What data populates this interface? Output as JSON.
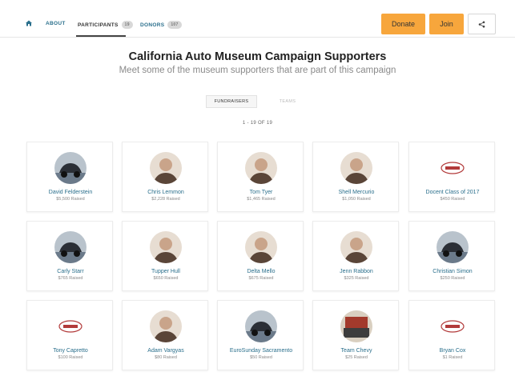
{
  "nav": {
    "about": "ABOUT",
    "participants": "PARTICIPANTS",
    "participants_count": "19",
    "donors": "DONORS",
    "donors_count": "107"
  },
  "actions": {
    "donate": "Donate",
    "join": "Join"
  },
  "header": {
    "title": "California Auto Museum Campaign Supporters",
    "subtitle": "Meet some of the museum supporters that are part of this campaign"
  },
  "tabs": {
    "fundraisers": "FUNDRAISERS",
    "teams": "TEAMS"
  },
  "count_text": "1 - 19 OF 19",
  "colors": {
    "accent": "#f7a63c",
    "link": "#2a6f8c"
  },
  "participants": [
    {
      "name": "David Felderstein",
      "raised": "$5,500 Raised",
      "avatar": "car-photo"
    },
    {
      "name": "Chris Lemmon",
      "raised": "$2,228 Raised",
      "avatar": "person-photo"
    },
    {
      "name": "Tom Tyer",
      "raised": "$1,465 Raised",
      "avatar": "person-photo"
    },
    {
      "name": "Shell Mercurio",
      "raised": "$1,050 Raised",
      "avatar": "person-photo"
    },
    {
      "name": "Docent Class of 2017",
      "raised": "$450 Raised",
      "avatar": "museum-logo"
    },
    {
      "name": "Carly Starr",
      "raised": "$765 Raised",
      "avatar": "car-photo"
    },
    {
      "name": "Tupper Hull",
      "raised": "$650 Raised",
      "avatar": "person-photo"
    },
    {
      "name": "Delta Mello",
      "raised": "$675 Raised",
      "avatar": "person-photo"
    },
    {
      "name": "Jenn Rabbon",
      "raised": "$325 Raised",
      "avatar": "person-photo"
    },
    {
      "name": "Christian Simon",
      "raised": "$250 Raised",
      "avatar": "car-photo"
    },
    {
      "name": "Tony Capretto",
      "raised": "$100 Raised",
      "avatar": "museum-logo"
    },
    {
      "name": "Adam Vargyas",
      "raised": "$80 Raised",
      "avatar": "person-photo"
    },
    {
      "name": "EuroSunday Sacramento",
      "raised": "$50 Raised",
      "avatar": "car-photo"
    },
    {
      "name": "Team Chevy",
      "raised": "$25 Raised",
      "avatar": "sign-photo"
    },
    {
      "name": "Bryan Cox",
      "raised": "$1 Raised",
      "avatar": "museum-logo"
    }
  ]
}
